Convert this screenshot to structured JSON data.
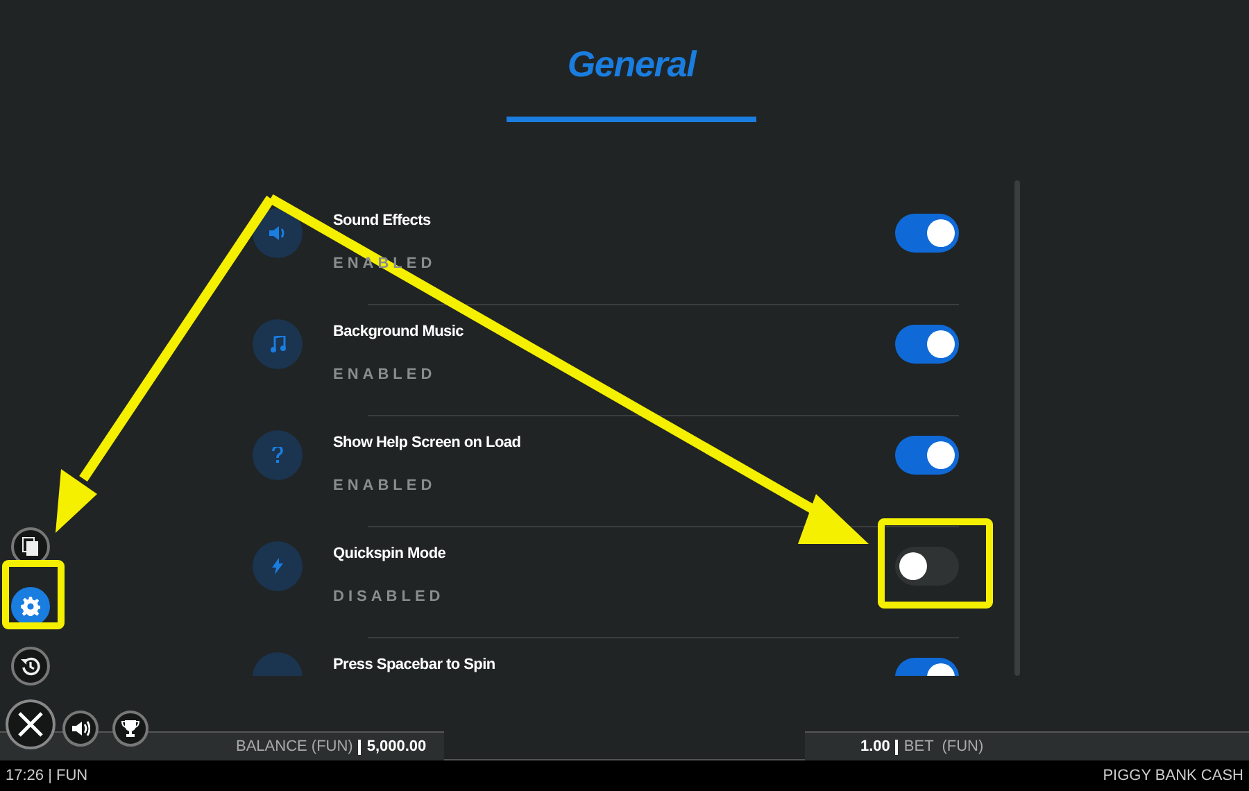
{
  "title": "General",
  "settings": [
    {
      "label": "Sound Effects",
      "status": "ENABLED",
      "on": true,
      "kind": "speaker"
    },
    {
      "label": "Background Music",
      "status": "ENABLED",
      "on": true,
      "kind": "music"
    },
    {
      "label": "Show Help Screen on Load",
      "status": "ENABLED",
      "on": true,
      "kind": "help"
    },
    {
      "label": "Quickspin Mode",
      "status": "DISABLED",
      "on": false,
      "kind": "bolt"
    },
    {
      "label": "Press Spacebar to Spin",
      "on": true,
      "kind": "spin"
    }
  ],
  "side_menu": [
    {
      "kind": "paytable",
      "selected": false
    },
    {
      "kind": "settings",
      "selected": true
    },
    {
      "kind": "history",
      "selected": false
    }
  ],
  "balance": {
    "label": "BALANCE (FUN)",
    "value": "5,000.00"
  },
  "bet": {
    "value": "1.00",
    "label": "BET  (FUN)"
  },
  "status_bar": {
    "clock": "17:26 | FUN",
    "game": "PIGGY BANK CASH"
  }
}
